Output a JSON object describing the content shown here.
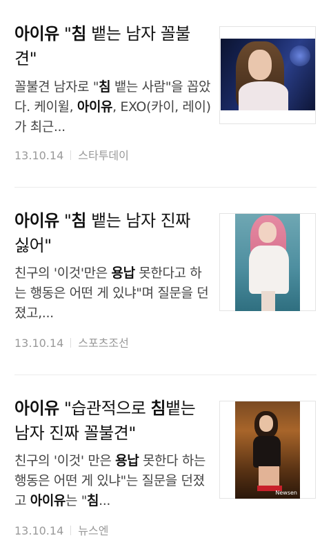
{
  "articles": [
    {
      "title_parts": [
        "아이유",
        " \"",
        "침",
        " 뱉는 남자 꼴불견\""
      ],
      "snippet_parts": [
        "꼴불견 남자로 \"",
        "침",
        " 뱉는 사람\"을 꼽았다. 케이윌, ",
        "아이유",
        ", EXO(카이, 레이)가 최근..."
      ],
      "date": "13.10.14",
      "source": "스타투데이",
      "thumbnail": "photo-singer-on-stage"
    },
    {
      "title_parts": [
        "아이유",
        " \"",
        "침",
        " 뱉는 남자 진짜 싫어\""
      ],
      "snippet_parts": [
        "친구의 '이것'만은 ",
        "용납",
        " 못한다고 하는 행동은 어떤 게 있냐\"며 질문을 던졌고,..."
      ],
      "date": "13.10.14",
      "source": "스포츠조선",
      "thumbnail": "photo-pink-hair-white-dress"
    },
    {
      "title_parts": [
        "아이유",
        " \"습관적으로 ",
        "침",
        "뱉는 남자 진짜 꼴불견\""
      ],
      "snippet_parts": [
        "친구의 '이것' 만은 ",
        "용납",
        " 못한다 하는 행동은 어떤 게 있냐\"는 질문을 던졌고 ",
        "아이유",
        "는 \"",
        "침",
        "..."
      ],
      "date": "13.10.14",
      "source": "뉴스엔",
      "thumbnail": "photo-seated-on-stage",
      "watermark": "Newsen"
    }
  ]
}
